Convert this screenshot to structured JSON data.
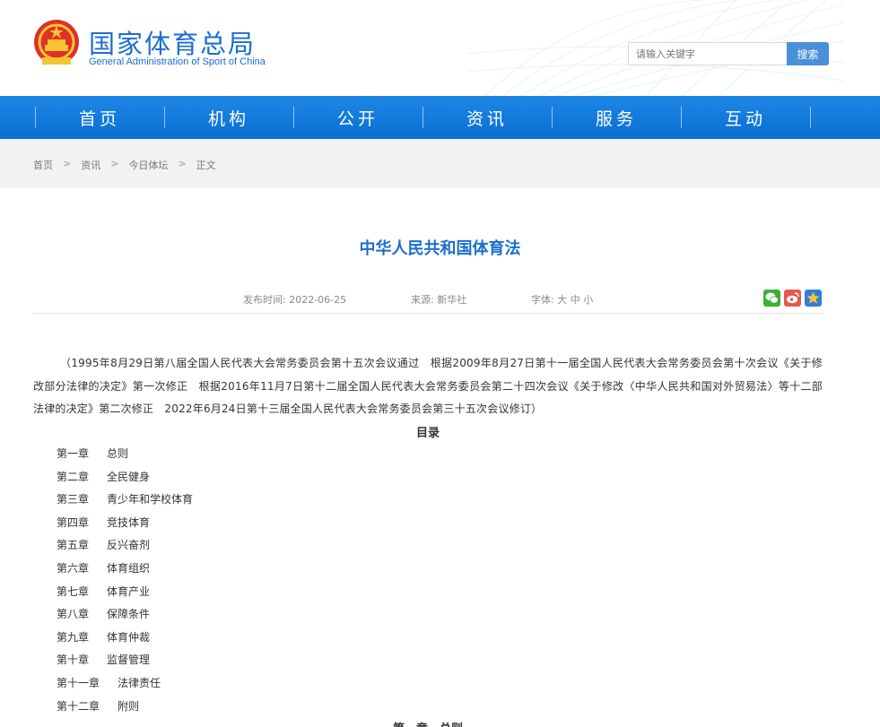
{
  "header": {
    "logo_cn": "国家体育总局",
    "logo_en": "General Administration of Sport of China",
    "search_placeholder": "请输入关键字",
    "search_button": "搜索"
  },
  "nav": [
    "首页",
    "机构",
    "公开",
    "资讯",
    "服务",
    "互动"
  ],
  "breadcrumb": [
    "首页",
    "资讯",
    "今日体坛",
    "正文"
  ],
  "breadcrumb_separator": ">",
  "article": {
    "title": "中华人民共和国体育法",
    "publish_label": "发布时间:",
    "publish_date": "2022-06-25",
    "source_label": "来源:",
    "source": "新华社",
    "font_label": "字体:",
    "font_sizes": [
      "大",
      "中",
      "小"
    ],
    "intro": "（1995年8月29日第八届全国人民代表大会常务委员会第十五次会议通过　根据2009年8月27日第十一届全国人民代表大会常务委员会第十次会议《关于修改部分法律的决定》第一次修正　根据2016年11月7日第十二届全国人民代表大会常务委员会第二十四次会议《关于修改〈中华人民共和国对外贸易法〉等十二部法律的决定》第二次修正　2022年6月24日第十三届全国人民代表大会常务委员会第三十五次会议修订）",
    "toc_heading": "目录",
    "toc": [
      {
        "num": "第一章",
        "title": "总则"
      },
      {
        "num": "第二章",
        "title": "全民健身"
      },
      {
        "num": "第三章",
        "title": "青少年和学校体育"
      },
      {
        "num": "第四章",
        "title": "竞技体育"
      },
      {
        "num": "第五章",
        "title": "反兴奋剂"
      },
      {
        "num": "第六章",
        "title": "体育组织"
      },
      {
        "num": "第七章",
        "title": "体育产业"
      },
      {
        "num": "第八章",
        "title": "保障条件"
      },
      {
        "num": "第九章",
        "title": "体育仲裁"
      },
      {
        "num": "第十章",
        "title": "监督管理"
      },
      {
        "num": "第十一章",
        "title": "法律责任"
      },
      {
        "num": "第十二章",
        "title": "附则"
      }
    ],
    "chapter_heading": "第一章　总则"
  },
  "colors": {
    "brand_blue": "#1b6ed1",
    "nav_blue": "#0a6fd2",
    "search_button": "#4a8fd9"
  },
  "icons": [
    "national-emblem-icon",
    "wechat-share-icon",
    "weibo-share-icon",
    "favorite-star-icon"
  ]
}
